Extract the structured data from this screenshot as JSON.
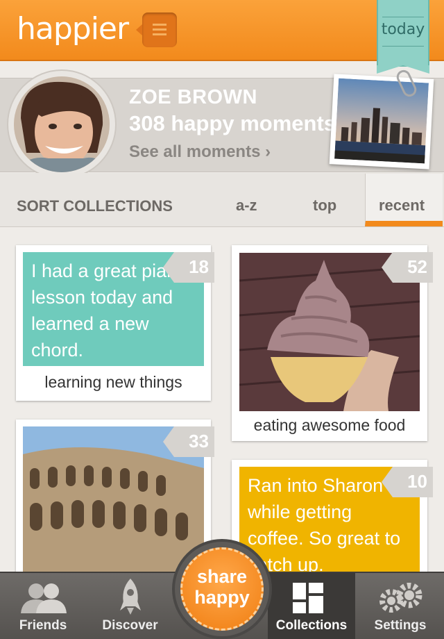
{
  "header": {
    "logo": "happier",
    "today_label": "today"
  },
  "profile": {
    "name": "ZOE BROWN",
    "moments": "308 happy moments",
    "see_all": "See all moments ›"
  },
  "sort": {
    "title": "SORT COLLECTIONS",
    "options": [
      "a-z",
      "top",
      "recent"
    ],
    "selected": "recent"
  },
  "collections": [
    {
      "note": "I had a great piano lesson today and learned a new chord.",
      "caption": "learning new things",
      "count": "18",
      "color": "#6fcbbc"
    },
    {
      "caption": "eating awesome food",
      "count": "52"
    },
    {
      "count": "33"
    },
    {
      "note": "Ran into Sharon while getting coffee. So great to catch up.",
      "count": "10",
      "color": "#f0b400"
    }
  ],
  "share": {
    "line1": "share",
    "line2": "happy"
  },
  "tabs": [
    {
      "label": "Friends",
      "icon": "friends-icon"
    },
    {
      "label": "Discover",
      "icon": "rocket-icon"
    },
    {
      "label": "Collections",
      "icon": "grid-icon"
    },
    {
      "label": "Settings",
      "icon": "gears-icon"
    }
  ],
  "colors": {
    "accent": "#f28a1c",
    "teal": "#6fcbbc",
    "yellow": "#f0b400"
  }
}
